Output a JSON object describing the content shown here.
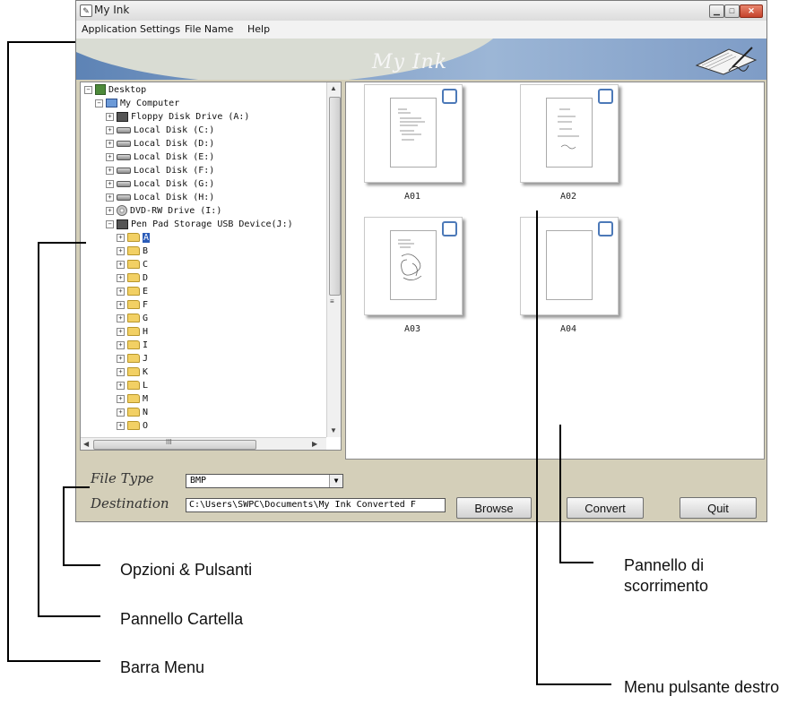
{
  "window": {
    "title": "My Ink"
  },
  "menu": {
    "items": [
      "Application Settings",
      "File Name",
      "Help"
    ]
  },
  "banner": {
    "title": "My Ink"
  },
  "tree": {
    "rows": [
      {
        "label": "Desktop",
        "icon": "desktop-icon"
      },
      {
        "label": "My Computer",
        "icon": "computer-icon"
      },
      {
        "label": "Floppy Disk Drive (A:)",
        "icon": "floppy-icon"
      },
      {
        "label": "Local Disk (C:)",
        "icon": "disk-icon"
      },
      {
        "label": "Local Disk (D:)",
        "icon": "disk-icon"
      },
      {
        "label": "Local Disk (E:)",
        "icon": "disk-icon"
      },
      {
        "label": "Local Disk (F:)",
        "icon": "disk-icon"
      },
      {
        "label": "Local Disk (G:)",
        "icon": "disk-icon"
      },
      {
        "label": "Local Disk (H:)",
        "icon": "disk-icon"
      },
      {
        "label": "DVD-RW Drive (I:)",
        "icon": "dvd-icon"
      },
      {
        "label": "Pen Pad Storage USB Device(J:)",
        "icon": "usb-drive-icon"
      },
      {
        "label": "A",
        "icon": "folder-icon",
        "selected": true
      },
      {
        "label": "B",
        "icon": "folder-icon"
      },
      {
        "label": "C",
        "icon": "folder-icon"
      },
      {
        "label": "D",
        "icon": "folder-icon"
      },
      {
        "label": "E",
        "icon": "folder-icon"
      },
      {
        "label": "F",
        "icon": "folder-icon"
      },
      {
        "label": "G",
        "icon": "folder-icon"
      },
      {
        "label": "H",
        "icon": "folder-icon"
      },
      {
        "label": "I",
        "icon": "folder-icon"
      },
      {
        "label": "J",
        "icon": "folder-icon"
      },
      {
        "label": "K",
        "icon": "folder-icon"
      },
      {
        "label": "L",
        "icon": "folder-icon"
      },
      {
        "label": "M",
        "icon": "folder-icon"
      },
      {
        "label": "N",
        "icon": "folder-icon"
      },
      {
        "label": "O",
        "icon": "folder-icon"
      }
    ],
    "hscroll_label": "III"
  },
  "thumbnails": [
    {
      "label": "A01"
    },
    {
      "label": "A02"
    },
    {
      "label": "A03"
    },
    {
      "label": "A04"
    }
  ],
  "options": {
    "file_type_label": "File Type",
    "file_type_value": "BMP",
    "destination_label": "Destination",
    "destination_value": "C:\\Users\\SWPC\\Documents\\My Ink Converted F",
    "browse_label": "Browse",
    "convert_label": "Convert",
    "quit_label": "Quit"
  },
  "callouts": {
    "options_buttons": "Opzioni & Pulsanti",
    "folder_panel": "Pannello Cartella",
    "menu_bar": "Barra Menu",
    "scroll_panel": "Pannello di scorrimento",
    "right_click_menu": "Menu pulsante destro"
  }
}
